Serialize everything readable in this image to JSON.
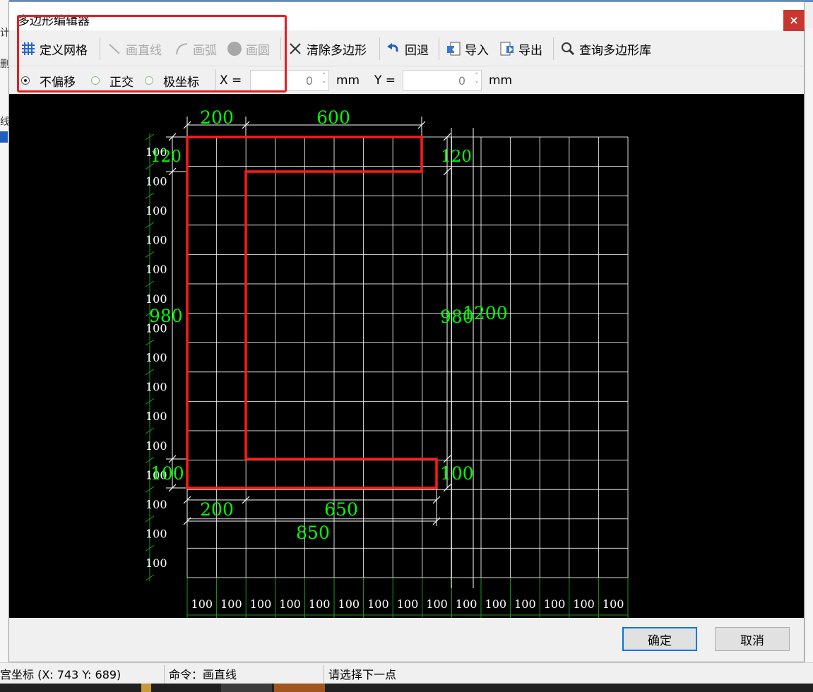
{
  "window": {
    "title": "多边形编辑器",
    "close_glyph": "×"
  },
  "background": {
    "left_chars": [
      "计",
      "删",
      "线"
    ]
  },
  "toolbar": {
    "define_grid": "定义网格",
    "draw_line": "画直线",
    "draw_arc": "画弧",
    "draw_circle": "画圆",
    "clear_polygon": "清除多边形",
    "undo": "回退",
    "import": "导入",
    "export": "导出",
    "query_library": "查询多边形库"
  },
  "options": {
    "no_offset": "不偏移",
    "orthogonal": "正交",
    "polar": "极坐标",
    "selected": "no_offset",
    "x_label": "X =",
    "x_value": "0",
    "x_unit": "mm",
    "y_label": "Y =",
    "y_value": "0",
    "y_unit": "mm"
  },
  "drawing": {
    "grid_label": "100",
    "dims": {
      "top_left": "200",
      "top_right": "600",
      "left_top": "120",
      "left_mid": "980",
      "left_bottom": "100",
      "right_top": "120",
      "right_mid": "980",
      "right_total": "1200",
      "right_bottom": "100",
      "bottom_left": "200",
      "bottom_right": "650",
      "bottom_total": "850"
    },
    "colors": {
      "outline": "#ff1a1a",
      "dimension": "#00ff00",
      "grid": "#ffffff",
      "background": "#000000"
    }
  },
  "buttons": {
    "ok": "确定",
    "cancel": "取消"
  },
  "status": {
    "coords": "宫坐标 (X: 743 Y: 689)",
    "command": "命令：画直线",
    "prompt": "请选择下一点"
  },
  "highlight_color": "#e61e1e"
}
